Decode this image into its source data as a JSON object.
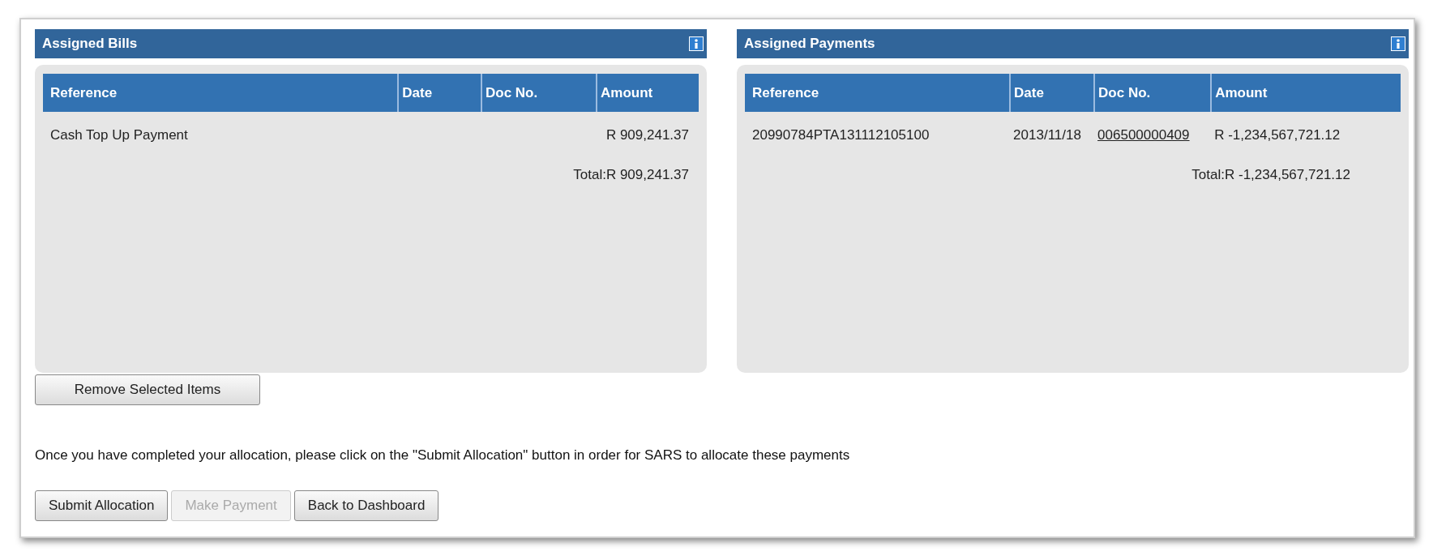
{
  "panels": [
    {
      "title": "Assigned Bills",
      "columns": [
        "Reference",
        "Date",
        "Doc No.",
        "Amount"
      ],
      "rows": [
        {
          "reference": "Cash Top Up Payment",
          "date": "",
          "doc_no": "",
          "amount": "R 909,241.37"
        }
      ],
      "total": "Total:R 909,241.37"
    },
    {
      "title": "Assigned Payments",
      "columns": [
        "Reference",
        "Date",
        "Doc No.",
        "Amount"
      ],
      "rows": [
        {
          "reference": "20990784PTA131112105100",
          "date": "2013/11/18",
          "doc_no": "006500000409",
          "amount": "R -1,234,567,721.12"
        }
      ],
      "total": "Total:R -1,234,567,721.12"
    }
  ],
  "remove_button": {
    "label": "Remove Selected Items",
    "disabled": false
  },
  "instruction": "Once you have completed your allocation, please click on the \"Submit Allocation\" button in order for SARS to allocate these payments",
  "buttons": [
    {
      "label": "Submit Allocation",
      "disabled": false
    },
    {
      "label": "Make Payment",
      "disabled": true
    },
    {
      "label": "Back to Dashboard",
      "disabled": false
    }
  ]
}
